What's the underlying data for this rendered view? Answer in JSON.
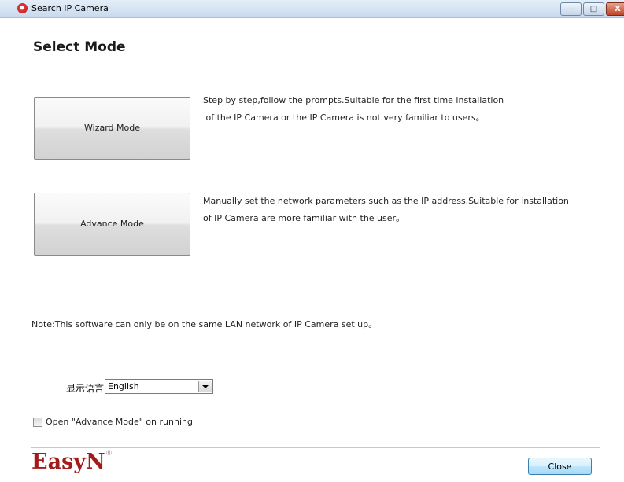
{
  "window": {
    "title": "Search IP Camera",
    "controls": {
      "minimize": "–",
      "maximize": "□",
      "close": "X"
    }
  },
  "header": {
    "title": "Select Mode"
  },
  "modes": [
    {
      "label": "Wizard Mode",
      "desc_line1": "Step by step,follow the prompts.Suitable for the first time installation",
      "desc_line2": " of the IP Camera or the IP Camera is not very familiar to users。"
    },
    {
      "label": "Advance Mode",
      "desc_line1": "Manually set the network parameters such as the IP address.Suitable for installation",
      "desc_line2": "of IP Camera are more familiar with the user。"
    }
  ],
  "note": "Note:This software can only be on the same LAN network of IP Camera set up。",
  "language": {
    "label": "显示语言",
    "selected": "English"
  },
  "advance_on_start": {
    "label": "Open \"Advance Mode\" on running",
    "checked": false
  },
  "footer": {
    "logo": "EasyN",
    "logo_mark": "®",
    "close_label": "Close"
  },
  "colors": {
    "logo": "#a31a1a",
    "close_button_border": "#3c7fb1"
  }
}
